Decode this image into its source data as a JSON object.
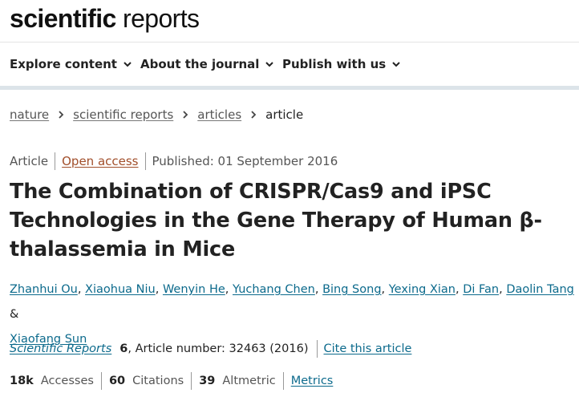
{
  "brand": {
    "logo_bold": "scientific",
    "logo_light": " reports"
  },
  "nav": {
    "items": [
      {
        "label": "Explore content",
        "icon": "chevron-down-icon"
      },
      {
        "label": "About the journal",
        "icon": "chevron-down-icon"
      },
      {
        "label": "Publish with us",
        "icon": "chevron-down-icon"
      }
    ]
  },
  "breadcrumb": {
    "items": [
      "nature",
      "scientific reports",
      "articles"
    ],
    "current": "article",
    "separator_icon": "chevron-right-icon"
  },
  "article": {
    "type": "Article",
    "access": "Open access",
    "published": "Published: 01 September 2016",
    "title": "The Combination of CRISPR/Cas9 and iPSC Technologies in the Gene Therapy of Human β-thalassemia in Mice",
    "authors": [
      "Zhanhui Ou",
      "Xiaohua Niu",
      "Wenyin He",
      "Yuchang Chen",
      "Bing Song",
      "Yexing Xian",
      "Di Fan",
      "Daolin Tang",
      "Xiaofang Sun"
    ],
    "author_joiner": ",",
    "author_last_joiner": "&"
  },
  "citation": {
    "journal": "Scientific Reports",
    "volume": "6",
    "article_number": ", Article number: 32463 (2016)",
    "cite_label": "Cite this article"
  },
  "metrics": {
    "accesses_value": "18k",
    "accesses_label": "Accesses",
    "citations_value": "60",
    "citations_label": "Citations",
    "altmetric_value": "39",
    "altmetric_label": "Altmetric",
    "metrics_link": "Metrics"
  },
  "colors": {
    "link": "#0c6a8c",
    "open_access": "#a14e2a",
    "nav_rule": "#dce4e9",
    "text": "#222222",
    "muted": "#555555"
  }
}
